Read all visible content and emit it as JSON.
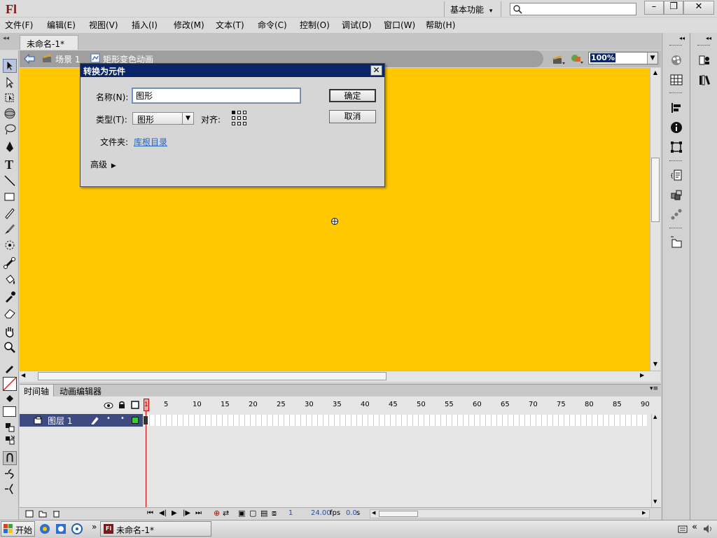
{
  "app": {
    "logo": "Fl",
    "workspace": "基本功能",
    "workspace_arrow": "▾",
    "search_placeholder": ""
  },
  "window_controls": {
    "minimize": "–",
    "restore": "❐",
    "close": "✕"
  },
  "menu": [
    "文件(F)",
    "编辑(E)",
    "视图(V)",
    "插入(I)",
    "修改(M)",
    "文本(T)",
    "命令(C)",
    "控制(O)",
    "调试(D)",
    "窗口(W)",
    "帮助(H)"
  ],
  "document_tab": {
    "title": "未命名-1*",
    "close": "×"
  },
  "breadcrumb": {
    "scene": "场景 1",
    "symbol": "矩形变色动画"
  },
  "zoom": "100%",
  "dialog": {
    "title": "转换为元件",
    "close": "✕",
    "name_label": "名称(N):",
    "name_value": "图形",
    "type_label": "类型(T):",
    "type_value": "图形",
    "align_label": "对齐:",
    "folder_label": "文件夹:",
    "folder_link": "库根目录",
    "advanced_label": "高级",
    "ok_label": "确定",
    "cancel_label": "取消"
  },
  "stage": {
    "background_color": "#ffc800"
  },
  "timeline": {
    "tabs": [
      "时间轴",
      "动画编辑器"
    ],
    "layer_name": "图层 1",
    "frame_numbers": [
      "1",
      "5",
      "10",
      "15",
      "20",
      "25",
      "30",
      "35",
      "40",
      "45",
      "50",
      "55",
      "60",
      "65",
      "70",
      "75",
      "80",
      "85",
      "90"
    ],
    "current_frame": "1",
    "fps": "24.00",
    "fps_unit": "fps",
    "elapsed": "0.0",
    "elapsed_unit": "s"
  },
  "taskbar": {
    "start": "开始",
    "task": "未命名-1*",
    "chevron": "»",
    "tray_chevron": "«"
  }
}
